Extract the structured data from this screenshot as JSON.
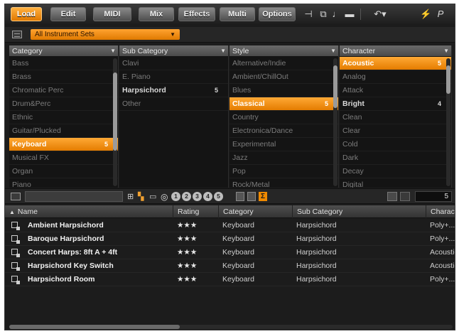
{
  "toolbar": {
    "buttons": [
      "Load",
      "Edit",
      "MIDI",
      "Mix",
      "Effects",
      "Multi",
      "Options"
    ],
    "active": "Load",
    "icons": [
      "plug-icon",
      "copy-icon",
      "key-icon",
      "lock-icon",
      "undo-icon",
      "tune-icon",
      "p-icon"
    ]
  },
  "instrument_set": {
    "label": "All Instrument Sets"
  },
  "filters": {
    "category": {
      "header": "Category",
      "items": [
        "Bass",
        "Brass",
        "Chromatic Perc",
        "Drum&Perc",
        "Ethnic",
        "Guitar/Plucked",
        "Keyboard",
        "Musical FX",
        "Organ",
        "Piano"
      ],
      "selected": "Keyboard",
      "selected_count": "5"
    },
    "subcategory": {
      "header": "Sub Category",
      "items": [
        "Clavi",
        "E. Piano",
        "Harpsichord",
        "Other"
      ],
      "highlighted": "Harpsichord",
      "highlighted_count": "5"
    },
    "style": {
      "header": "Style",
      "items": [
        "Alternative/Indie",
        "Ambient/ChillOut",
        "Blues",
        "Classical",
        "Country",
        "Electronica/Dance",
        "Experimental",
        "Jazz",
        "Pop",
        "Rock/Metal"
      ],
      "selected": "Classical",
      "selected_count": "5"
    },
    "character": {
      "header": "Character",
      "items": [
        "Acoustic",
        "Analog",
        "Attack",
        "Bright",
        "Clean",
        "Clear",
        "Cold",
        "Dark",
        "Decay",
        "Digital"
      ],
      "selected": "Acoustic",
      "selected_count": "5",
      "highlighted": "Bright",
      "highlighted_count": "4"
    }
  },
  "results_bar": {
    "rating_pills": [
      "1",
      "2",
      "3",
      "4",
      "5"
    ],
    "sigma": "Σ",
    "count": "5"
  },
  "results": {
    "columns": [
      "Name",
      "Rating",
      "Category",
      "Sub Category",
      "Character"
    ],
    "rows": [
      [
        "Ambient Harpsichord",
        "★★★",
        "Keyboard",
        "Harpsichord",
        "Poly+..."
      ],
      [
        "Baroque Harpsichord",
        "★★★",
        "Keyboard",
        "Harpsichord",
        "Poly+..."
      ],
      [
        "Concert Harps: 8ft A + 4ft",
        "★★★",
        "Keyboard",
        "Harpsichord",
        "Acoustic"
      ],
      [
        "Harpsichord Key Switch",
        "★★★",
        "Keyboard",
        "Harpsichord",
        "Acoustic"
      ],
      [
        "Harpsichord Room",
        "★★★",
        "Keyboard",
        "Harpsichord",
        "Poly+..."
      ]
    ]
  },
  "colors": {
    "accent": "#f08a00",
    "background": "#1c1c1c"
  }
}
